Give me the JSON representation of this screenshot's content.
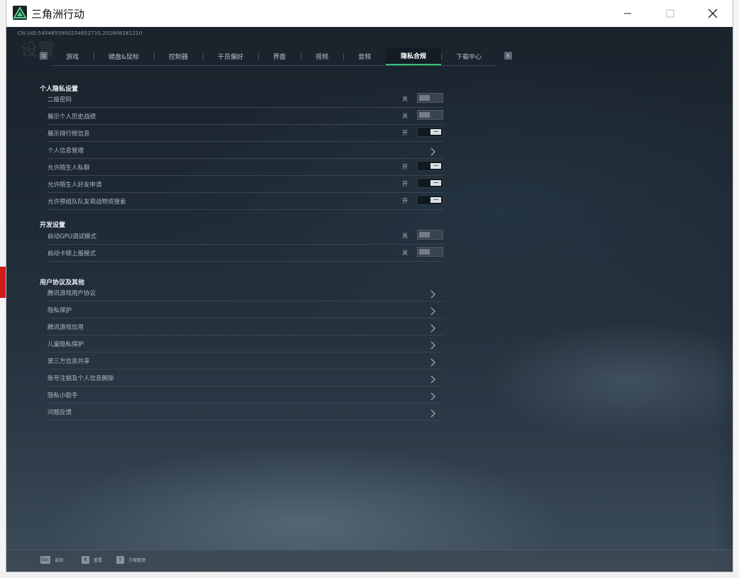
{
  "window": {
    "title": "三角洲行动"
  },
  "game": {
    "uid": "CN UID:545485590025465273S.202608281210",
    "ghost_title": "设置"
  },
  "tabs": [
    {
      "label": "游戏",
      "active": false
    },
    {
      "label": "键盘&鼠标",
      "active": false
    },
    {
      "label": "控制器",
      "active": false
    },
    {
      "label": "干员偏好",
      "active": false
    },
    {
      "label": "界面",
      "active": false
    },
    {
      "label": "视频",
      "active": false
    },
    {
      "label": "音频",
      "active": false
    },
    {
      "label": "隐私合规",
      "active": true
    },
    {
      "label": "下载中心",
      "active": false
    }
  ],
  "tab_keys": {
    "prev": "Q",
    "next": "E"
  },
  "sections": {
    "privacy": {
      "title": "个人隐私设置",
      "rows": [
        {
          "label": "二级密码",
          "state": "关",
          "type": "toggle",
          "on": false
        },
        {
          "label": "展示个人历史战绩",
          "state": "关",
          "type": "toggle",
          "on": false
        },
        {
          "label": "展示排行榜信息",
          "state": "开",
          "type": "toggle",
          "on": true
        },
        {
          "label": "个人信息管理",
          "type": "link"
        },
        {
          "label": "允许陌生人私聊",
          "state": "开",
          "type": "toggle",
          "on": true
        },
        {
          "label": "允许陌生人好友申请",
          "state": "开",
          "type": "toggle",
          "on": true
        },
        {
          "label": "允许预组队队友观战物资搜索",
          "state": "开",
          "type": "toggle",
          "on": true
        }
      ]
    },
    "dev": {
      "title": "开发设置",
      "rows": [
        {
          "label": "启动GPU调试模式",
          "state": "关",
          "type": "toggle",
          "on": false
        },
        {
          "label": "启动卡顿上报模式",
          "state": "关",
          "type": "toggle",
          "on": false
        }
      ]
    },
    "agreements": {
      "title": "用户协议及其他",
      "rows": [
        {
          "label": "腾讯游戏用户协议",
          "type": "link"
        },
        {
          "label": "隐私保护",
          "type": "link"
        },
        {
          "label": "腾讯游戏信用",
          "type": "link"
        },
        {
          "label": "儿童隐私保护",
          "type": "link"
        },
        {
          "label": "第三方信息共享",
          "type": "link"
        },
        {
          "label": "账号注销及个人信息删除",
          "type": "link"
        },
        {
          "label": "隐私小助手",
          "type": "link"
        },
        {
          "label": "问题反馈",
          "type": "link"
        }
      ]
    }
  },
  "footer": [
    {
      "key": "Esc",
      "label": "返回"
    },
    {
      "key": "R",
      "label": "重置"
    },
    {
      "key": "T",
      "label": "方案管理"
    }
  ],
  "colors": {
    "accent": "#34c37a",
    "panel": "#1b2530"
  }
}
